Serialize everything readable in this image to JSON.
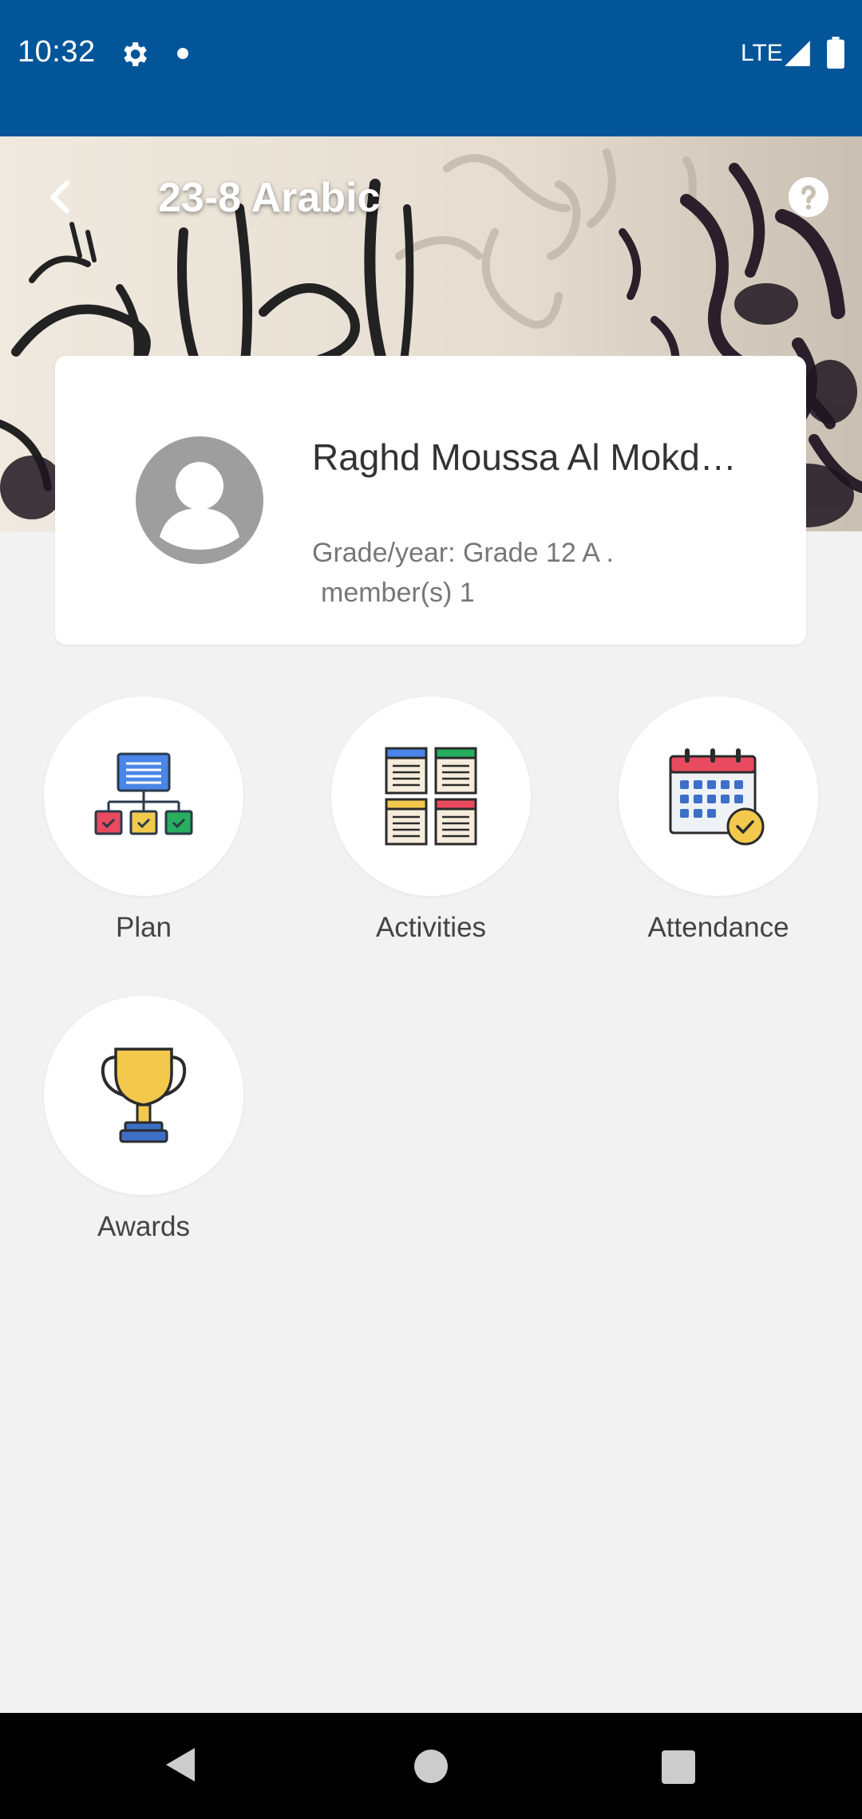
{
  "status_bar": {
    "time": "10:32",
    "network": "LTE",
    "icons": [
      "gear-icon",
      "dot-icon",
      "signal-icon",
      "battery-icon"
    ],
    "background": "#025599"
  },
  "header": {
    "title": "23-8 Arabic",
    "back_icon": "chevron-left-icon",
    "help_icon": "help-icon"
  },
  "profile": {
    "name": "Raghd Moussa Al Mokd…",
    "grade_line": "Grade/year: Grade 12 A   .",
    "members_line": "member(s) 1",
    "avatar_icon": "avatar-placeholder-icon"
  },
  "tiles": [
    {
      "label": "Plan",
      "icon": "plan-hierarchy-icon"
    },
    {
      "label": "Activities",
      "icon": "activities-grid-icon"
    },
    {
      "label": "Attendance",
      "icon": "calendar-check-icon"
    },
    {
      "label": "Awards",
      "icon": "trophy-icon"
    }
  ],
  "nav_bar": {
    "icons": [
      "nav-back-icon",
      "nav-home-icon",
      "nav-recents-icon"
    ]
  }
}
